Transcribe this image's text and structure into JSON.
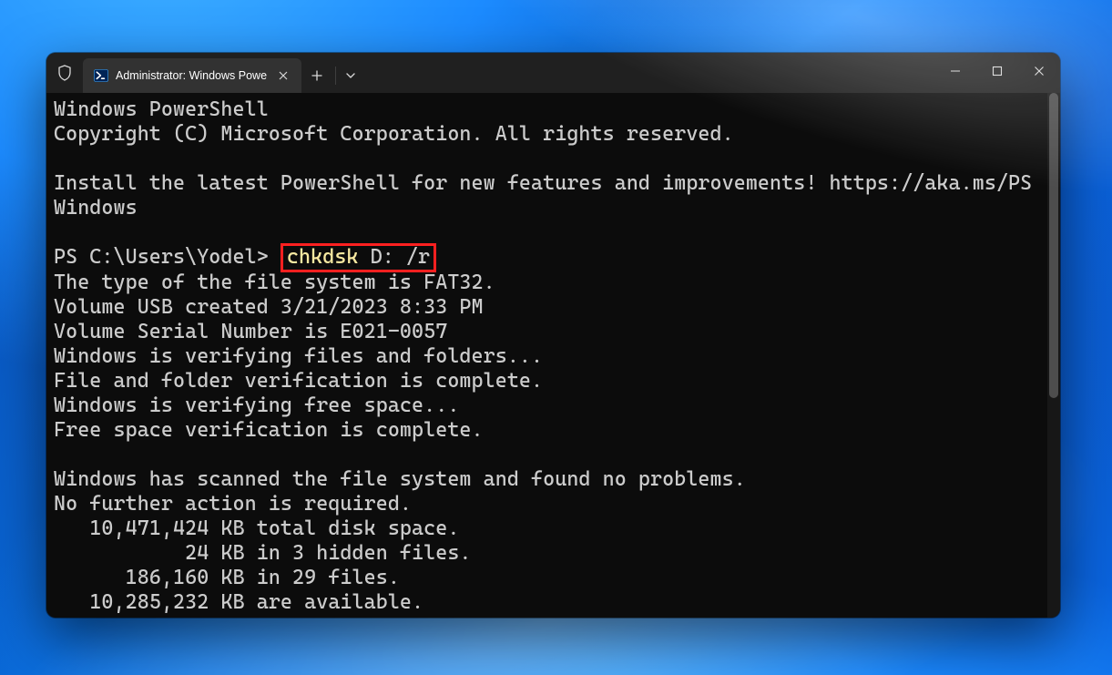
{
  "titlebar": {
    "tab_title": "Administrator: Windows Powe"
  },
  "terminal": {
    "banner_line1": "Windows PowerShell",
    "banner_line2": "Copyright (C) Microsoft Corporation. All rights reserved.",
    "install_msg": "Install the latest PowerShell for new features and improvements! https://aka.ms/PSWindows",
    "prompt_prefix": "PS C:\\Users\\Yodel> ",
    "command_exe": "chkdsk",
    "command_args": " D: /r",
    "out1": "The type of the file system is FAT32.",
    "out2": "Volume USB created 3/21/2023 8:33 PM",
    "out3": "Volume Serial Number is E021-0057",
    "out4": "Windows is verifying files and folders...",
    "out5": "File and folder verification is complete.",
    "out6": "Windows is verifying free space...",
    "out7": "Free space verification is complete.",
    "out8": "Windows has scanned the file system and found no problems.",
    "out9": "No further action is required.",
    "out10": "   10,471,424 KB total disk space.",
    "out11": "           24 KB in 3 hidden files.",
    "out12": "      186,160 KB in 29 files.",
    "out13": "   10,285,232 KB are available."
  }
}
